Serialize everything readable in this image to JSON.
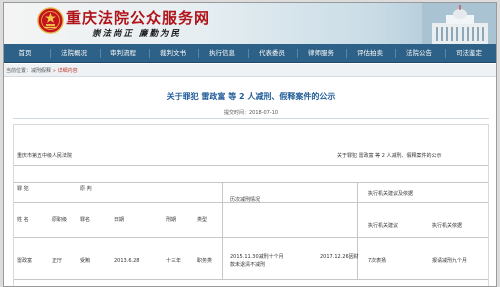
{
  "header": {
    "site_title": "重庆法院公众服务网",
    "motto": "崇法尚正  廉勤为民"
  },
  "nav": {
    "items": [
      "首页",
      "法院概况",
      "审判流程",
      "裁判文书",
      "执行信息",
      "代表委员",
      "律师服务",
      "评估拍卖",
      "法院公告",
      "司法鉴定"
    ]
  },
  "breadcrumb": {
    "prefix": "当前位置：",
    "section": "减刑假释",
    "separator": ">",
    "current": "详细内容"
  },
  "article": {
    "title": "关于罪犯 雷政富 等 2 人减刑、假释案件的公示",
    "date_label": "提交时间：",
    "date": "2018-07-10"
  },
  "document": {
    "court": "重庆市第五中级人民法院",
    "notice_title": "关于罪犯 雷政富 等 2 人减刑、假释案件的公示",
    "group_criminal": "罪 犯",
    "group_sentence": "原 判",
    "col_history": "历次减刑情况",
    "col_proposal": "执行机关建议及依据",
    "headers": {
      "name": "姓 名",
      "post": "原职级",
      "crime": "罪名",
      "date": "日期",
      "term": "刑期",
      "type": "类型",
      "proposal_text": "执行机关建议",
      "proposal_basis": "执行机关依据"
    },
    "row": {
      "name": "雷政富",
      "post": "正厅",
      "crime": "受贿",
      "date": "2013.6.28",
      "term": "十三年",
      "type": "职务类",
      "history": "2015.11.30减刑十个月",
      "history_2": "2017.12.26因财",
      "history_note": "款未退清不减刑",
      "basis": "7次表扬",
      "proposal": "报请减刑九个月"
    }
  }
}
